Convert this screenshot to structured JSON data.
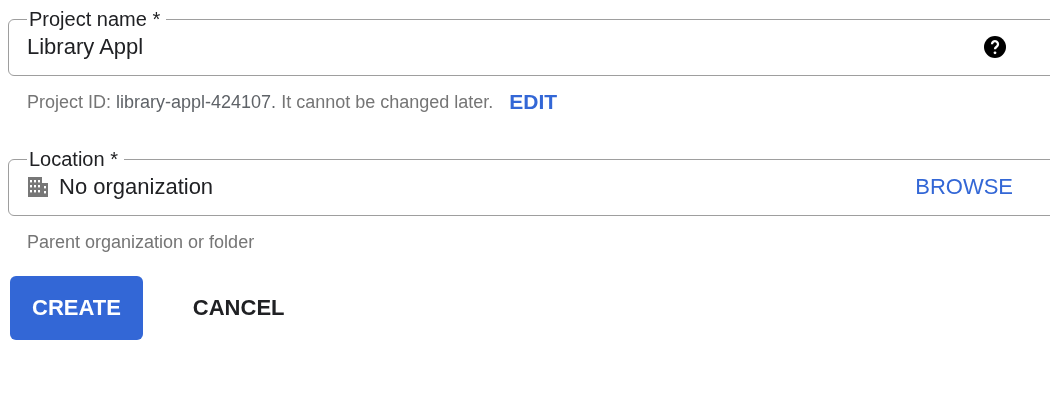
{
  "fields": [
    {
      "kind": "text",
      "label": "Project name *",
      "value": "Library Appl",
      "helper": "Project ID: **library-appl-424107.** It cannot be changed later.",
      "helper_link": "EDIT"
    },
    {
      "kind": "picker",
      "label": "Location *",
      "value": "No organization",
      "action": "BROWSE",
      "helper": "Parent organization or folder"
    }
  ],
  "buttons": [
    {
      "label": "CREATE",
      "kind": "primary"
    },
    {
      "label": "CANCEL",
      "kind": "text"
    }
  ]
}
